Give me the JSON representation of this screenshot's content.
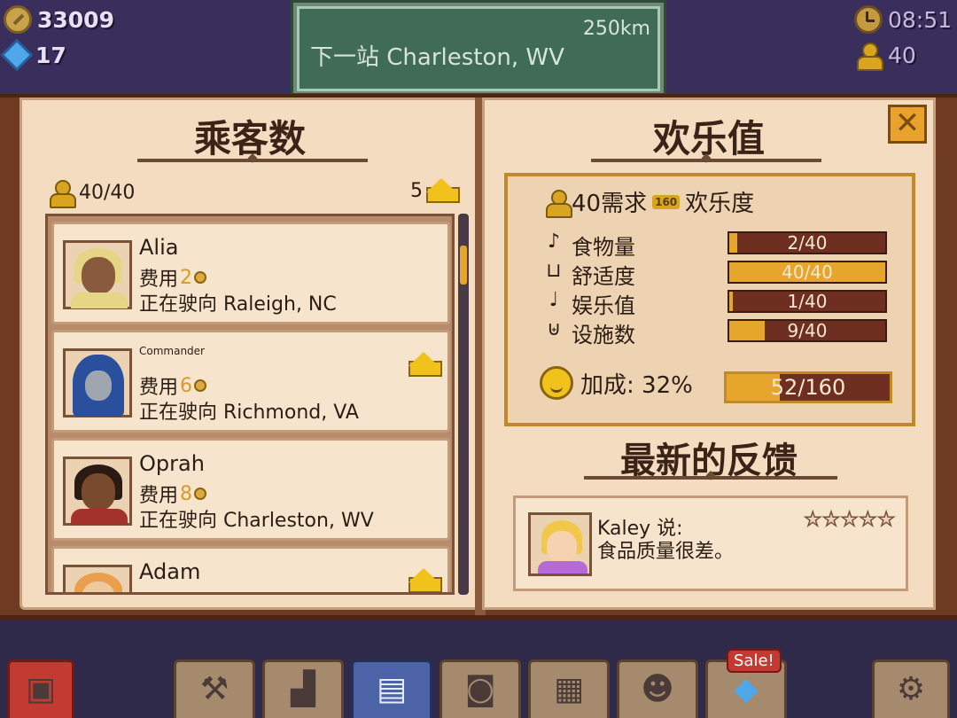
{
  "hud": {
    "coins": "33009",
    "gems": "17",
    "time": "08:51",
    "passengers": "40",
    "other": "0"
  },
  "station": {
    "distance": "250km",
    "next": "下一站 Charleston, WV"
  },
  "left_page": {
    "title": "乘客数",
    "passenger_count": "40/40",
    "vip_count": "5",
    "passengers": [
      {
        "name": "Alia",
        "title": "",
        "fee_label": "费用",
        "fee": "2",
        "dest": "正在驶向 Raleigh, NC",
        "vip": false
      },
      {
        "name": "",
        "title": "Commander",
        "fee_label": "费用",
        "fee": "6",
        "dest": "正在驶向 Richmond, VA",
        "vip": true
      },
      {
        "name": "Oprah",
        "title": "",
        "fee_label": "费用",
        "fee": "8",
        "dest": "正在驶向 Charleston, WV",
        "vip": false
      },
      {
        "name": "Adam",
        "title": "",
        "fee_label": "费用",
        "fee": "",
        "dest": "",
        "vip": true
      }
    ]
  },
  "right_page": {
    "title": "欢乐值",
    "demand_prefix": "40需求",
    "demand_badge": "160",
    "demand_suffix": "欢乐度",
    "stats": [
      {
        "label": "食物量",
        "value": "2/40",
        "fraction": 0.05,
        "icon": "food-icon"
      },
      {
        "label": "舒适度",
        "value": "40/40",
        "fraction": 1.0,
        "icon": "bed-icon"
      },
      {
        "label": "娱乐值",
        "value": "1/40",
        "fraction": 0.025,
        "icon": "music-icon"
      },
      {
        "label": "设施数",
        "value": "9/40",
        "fraction": 0.225,
        "icon": "toilet-icon"
      }
    ],
    "bonus_label": "加成: 32%",
    "total": "52/160",
    "total_fraction": 0.325,
    "feedback_title": "最新的反馈",
    "feedback": {
      "name": "Kaley 说:",
      "text": "食品质量很差。",
      "stars": 0
    }
  },
  "toolbar": {
    "sale_label": "Sale!",
    "buttons": [
      "depot-icon",
      "build-icon",
      "train-icon",
      "passenger-car-icon",
      "camera-icon",
      "map-icon",
      "staff-icon",
      "gem-shop-icon",
      "settings-icon"
    ]
  },
  "colors": {
    "accent": "#e6a52b",
    "bar_bg": "#6e2f20",
    "page": "#f3dcbf",
    "sign": "#3f6b57"
  }
}
